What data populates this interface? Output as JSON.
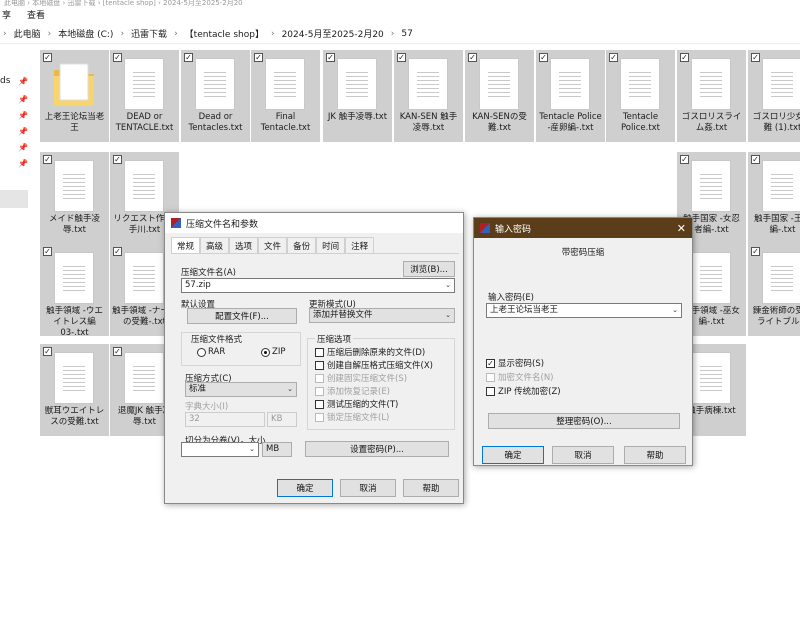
{
  "explorer": {
    "top_strip": "此电脑 › 本地磁盘 › 迅雷下载 › [tentacle shop] › 2024-5月至2025-2月20",
    "ribbon": [
      "享",
      "查看"
    ],
    "breadcrumb": [
      "此电脑",
      "本地磁盘 (C:)",
      "迅雷下载",
      "【tentacle shop】",
      "2024-5月至2025-2月20",
      "57"
    ],
    "nav_fragment": "ds",
    "files": [
      {
        "name": "上老王论坛当老王",
        "kind": "folder"
      },
      {
        "name": "DEAD or TENTACLE.txt",
        "kind": "txt"
      },
      {
        "name": "Dead or Tentacles.txt",
        "kind": "txt"
      },
      {
        "name": "Final Tentacle.txt",
        "kind": "txt"
      },
      {
        "name": "JK 触手凌辱.txt",
        "kind": "txt"
      },
      {
        "name": "KAN-SEN 触手凌辱.txt",
        "kind": "txt"
      },
      {
        "name": "KAN-SENの受難.txt",
        "kind": "txt"
      },
      {
        "name": "Tentacle Police -産卵編-.txt",
        "kind": "txt"
      },
      {
        "name": "Tentacle Police.txt",
        "kind": "txt"
      },
      {
        "name": "ゴスロリスライム姦.txt",
        "kind": "txt"
      },
      {
        "name": "ゴスロリ少女受難 (1).txt",
        "kind": "txt"
      },
      {
        "name": "メイド触手凌辱.txt",
        "kind": "txt"
      },
      {
        "name": "リクエスト作 古手川.txt",
        "kind": "txt"
      },
      {
        "name": "触手国家 -女忍者編-.txt",
        "kind": "txt"
      },
      {
        "name": "触手国家 -王様編-.txt",
        "kind": "txt"
      },
      {
        "name": "触手領域 -ウエイトレス編 03-.txt",
        "kind": "txt"
      },
      {
        "name": "触手領域 -ナースの受難-.txt",
        "kind": "txt"
      },
      {
        "name": "触手領域 -巫女編-.txt",
        "kind": "txt"
      },
      {
        "name": "錬金術師の受難ライトブルー",
        "kind": "txt"
      },
      {
        "name": "獣耳ウエイトレスの受難.txt",
        "kind": "txt"
      },
      {
        "name": "退魔JK 触手凌辱.txt",
        "kind": "txt"
      },
      {
        "name": "触手病棟.txt",
        "kind": "txt"
      }
    ]
  },
  "archive_dialog": {
    "title": "压缩文件名和参数",
    "tabs": [
      "常规",
      "高级",
      "选项",
      "文件",
      "备份",
      "时间",
      "注释"
    ],
    "archive_name_label": "压缩文件名(A)",
    "archive_name_value": "57.zip",
    "browse_button": "浏览(B)...",
    "default_profile_label": "默认设置",
    "profiles_button": "配置文件(F)...",
    "update_mode_label": "更新模式(U)",
    "update_mode_value": "添加并替换文件",
    "format_group": "压缩文件格式",
    "format_rar": "RAR",
    "format_zip": "ZIP",
    "compression_method_label": "压缩方式(C)",
    "compression_method_value": "标准",
    "dict_size_label": "字典大小(I)",
    "dict_size_value": "32",
    "dict_unit": "KB",
    "split_label": "切分为分卷(V)，大小",
    "split_unit": "MB",
    "options_group": "压缩选项",
    "options": [
      {
        "label": "压缩后删除原来的文件(D)",
        "enabled": true
      },
      {
        "label": "创建自解压格式压缩文件(X)",
        "enabled": true
      },
      {
        "label": "创建固实压缩文件(S)",
        "enabled": false
      },
      {
        "label": "添加恢复记录(E)",
        "enabled": false
      },
      {
        "label": "测试压缩的文件(T)",
        "enabled": true
      },
      {
        "label": "锁定压缩文件(L)",
        "enabled": false
      }
    ],
    "set_password_button": "设置密码(P)...",
    "ok_button": "确定",
    "cancel_button": "取消",
    "help_button": "帮助"
  },
  "password_dialog": {
    "title": "输入密码",
    "heading": "带密码压缩",
    "password_label": "输入密码(E)",
    "password_value": "上老王论坛当老王",
    "show_password": "显示密码(S)",
    "encrypt_names": "加密文件名(N)",
    "zip_legacy": "ZIP 传统加密(Z)",
    "organize_button": "整理密码(O)...",
    "ok_button": "确定",
    "cancel_button": "取消",
    "help_button": "帮助"
  }
}
